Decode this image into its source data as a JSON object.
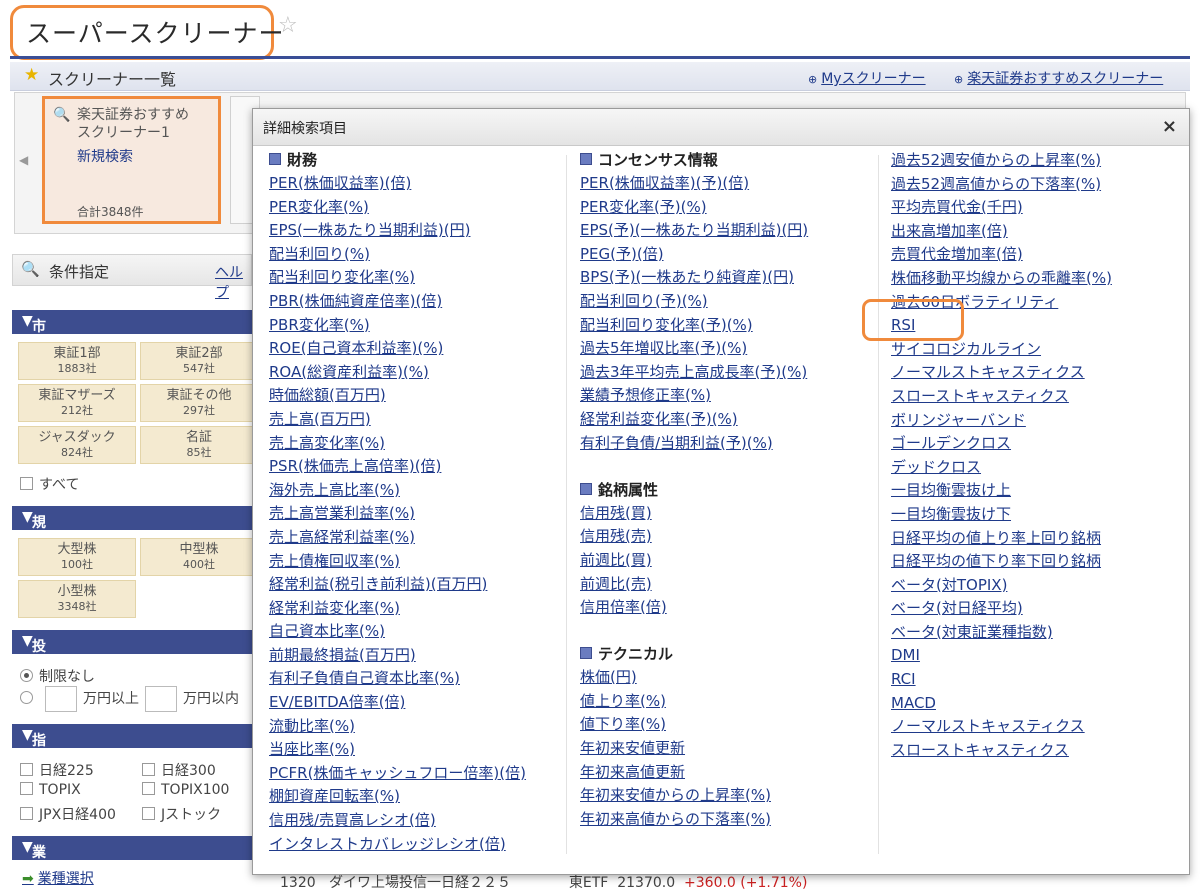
{
  "header": {
    "title": "スーパースクリーナー",
    "star": "☆"
  },
  "list_bar": {
    "title": "スクリーナー一覧",
    "my_link": "Myスクリーナー",
    "recommend_link": "楽天証券おすすめスクリーナー"
  },
  "card": {
    "name_line1": "楽天証券おすすめ",
    "name_line2": "スクリーナー1",
    "new_search": "新規検索",
    "total": "合計3848件"
  },
  "conditions": {
    "title": "条件指定",
    "help": "ヘルプ"
  },
  "market": {
    "header": "市場",
    "cells": [
      {
        "name": "東証1部",
        "count": "1883社"
      },
      {
        "name": "東証2部",
        "count": "547社"
      },
      {
        "name": "東証マザーズ",
        "count": "212社"
      },
      {
        "name": "東証その他",
        "count": "297社"
      },
      {
        "name": "ジャスダック",
        "count": "824社"
      },
      {
        "name": "名証",
        "count": "85社"
      }
    ],
    "all_label": "すべて"
  },
  "scale": {
    "header": "規模",
    "cells": [
      {
        "name": "大型株",
        "count": "100社"
      },
      {
        "name": "中型株",
        "count": "400社"
      },
      {
        "name": "小型株",
        "count": "3348社"
      }
    ]
  },
  "investment": {
    "header": "投資金額",
    "no_limit": "制限なし",
    "over_suffix": "万円以上",
    "under_suffix": "万円以内"
  },
  "index": {
    "header": "指数採用銘柄",
    "items": [
      "日経225",
      "日経300",
      "TOPIX",
      "TOPIX100",
      "JPX日経400",
      "Jストック"
    ]
  },
  "industry": {
    "header": "業種",
    "select": "業種選択"
  },
  "bottom_row": {
    "code": "1320",
    "name": "ダイワ上場投信一日経２２５",
    "type": "東ETF",
    "price": "21370.0",
    "change": "+360.0 (+1.71%)"
  },
  "modal": {
    "title": "詳細検索項目",
    "close": "×",
    "col1": {
      "group": "財務",
      "items": [
        "PER(株価収益率)(倍)",
        "PER変化率(%)",
        "EPS(一株あたり当期利益)(円)",
        "配当利回り(%)",
        "配当利回り変化率(%)",
        "PBR(株価純資産倍率)(倍)",
        "PBR変化率(%)",
        "ROE(自己資本利益率)(%)",
        "ROA(総資産利益率)(%)",
        "時価総額(百万円)",
        "売上高(百万円)",
        "売上高変化率(%)",
        "PSR(株価売上高倍率)(倍)",
        "海外売上高比率(%)",
        "売上高営業利益率(%)",
        "売上高経常利益率(%)",
        "売上債権回収率(%)",
        "経常利益(税引き前利益)(百万円)",
        "経常利益変化率(%)",
        "自己資本比率(%)",
        "前期最終損益(百万円)",
        "有利子負債自己資本比率(%)",
        "EV/EBITDA倍率(倍)",
        "流動比率(%)",
        "当座比率(%)",
        "PCFR(株価キャッシュフロー倍率)(倍)",
        "棚卸資産回転率(%)",
        "信用残/売買高レシオ(倍)",
        "インタレストカバレッジレシオ(倍)"
      ]
    },
    "col2": {
      "groups": [
        {
          "name": "コンセンサス情報",
          "items": [
            "PER(株価収益率)(予)(倍)",
            "PER変化率(予)(%)",
            "EPS(予)(一株あたり当期利益)(円)",
            "PEG(予)(倍)",
            "BPS(予)(一株あたり純資産)(円)",
            "配当利回り(予)(%)",
            "配当利回り変化率(予)(%)",
            "過去5年増収比率(予)(%)",
            "過去3年平均売上高成長率(予)(%)",
            "業績予想修正率(%)",
            "経常利益変化率(予)(%)",
            "有利子負債/当期利益(予)(%)"
          ]
        },
        {
          "name": "銘柄属性",
          "items": [
            "信用残(買)",
            "信用残(売)",
            "前週比(買)",
            "前週比(売)",
            "信用倍率(倍)"
          ]
        },
        {
          "name": "テクニカル",
          "items": [
            "株価(円)",
            "値上り率(%)",
            "値下り率(%)",
            "年初来安値更新",
            "年初来高値更新",
            "年初来安値からの上昇率(%)",
            "年初来高値からの下落率(%)"
          ]
        }
      ]
    },
    "col3": {
      "items": [
        "過去52週安値からの上昇率(%)",
        "過去52週高値からの下落率(%)",
        "平均売買代金(千円)",
        "出来高増加率(倍)",
        "売買代金増加率(倍)",
        "株価移動平均線からの乖離率(%)",
        "過去60日ボラティリティ",
        "RSI",
        "サイコロジカルライン",
        "ノーマルストキャスティクス",
        "スローストキャスティクス",
        "ボリンジャーバンド",
        "ゴールデンクロス",
        "デッドクロス",
        "一目均衡雲抜け上",
        "一目均衡雲抜け下",
        "日経平均の値上り率上回り銘柄",
        "日経平均の値下り率下回り銘柄",
        "ベータ(対TOPIX)",
        "ベータ(対日経平均)",
        "ベータ(対東証業種指数)",
        "DMI",
        "RCI",
        "MACD",
        "ノーマルストキャスティクス",
        "スローストキャスティクス"
      ]
    }
  },
  "colors": {
    "highlight": "#f08a3c",
    "nav_blue": "#3d4d8f",
    "link": "#1f3a8a"
  }
}
